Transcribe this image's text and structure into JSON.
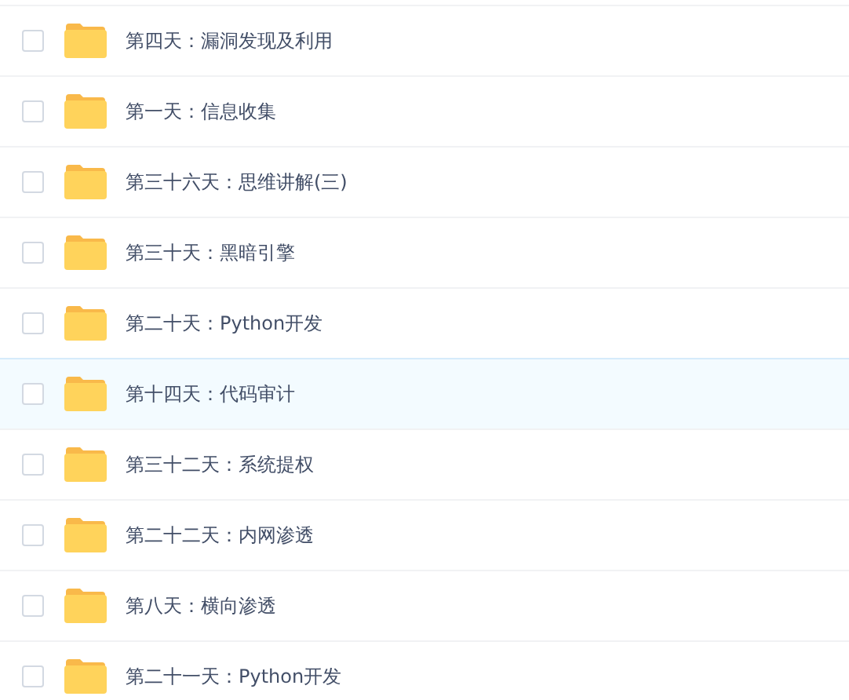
{
  "files": [
    {
      "name": "第四天：漏洞发现及利用",
      "checked": false,
      "selected": false
    },
    {
      "name": "第一天：信息收集",
      "checked": false,
      "selected": false
    },
    {
      "name": "第三十六天：思维讲解(三)",
      "checked": false,
      "selected": false
    },
    {
      "name": "第三十天：黑暗引擎",
      "checked": false,
      "selected": false
    },
    {
      "name": "第二十天：Python开发",
      "checked": false,
      "selected": false
    },
    {
      "name": "第十四天：代码审计",
      "checked": false,
      "selected": true
    },
    {
      "name": "第三十二天：系统提权",
      "checked": false,
      "selected": false
    },
    {
      "name": "第二十二天：内网渗透",
      "checked": false,
      "selected": false
    },
    {
      "name": "第八天：横向渗透",
      "checked": false,
      "selected": false
    },
    {
      "name": "第二十一天：Python开发",
      "checked": false,
      "selected": false
    }
  ]
}
